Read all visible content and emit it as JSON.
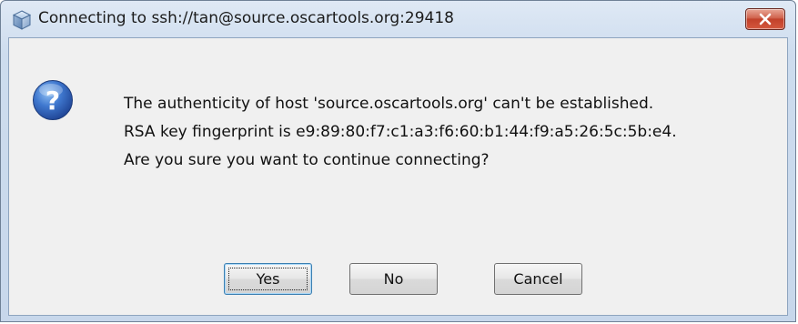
{
  "window": {
    "title": "Connecting to ssh://tan@source.oscartools.org:29418"
  },
  "dialog": {
    "icon": "question-icon",
    "message_lines": [
      "The authenticity of host 'source.oscartools.org' can't be established.",
      "RSA key fingerprint is e9:89:80:f7:c1:a3:f6:60:b1:44:f9:a5:26:5c:5b:e4.",
      "Are you sure you want to continue connecting?"
    ]
  },
  "buttons": {
    "yes": "Yes",
    "no": "No",
    "cancel": "Cancel"
  },
  "colors": {
    "title_bar": "#cddcee",
    "client_bg": "#f0f0f0",
    "close_button": "#c2412a",
    "question_icon": "#2a5fb8"
  }
}
